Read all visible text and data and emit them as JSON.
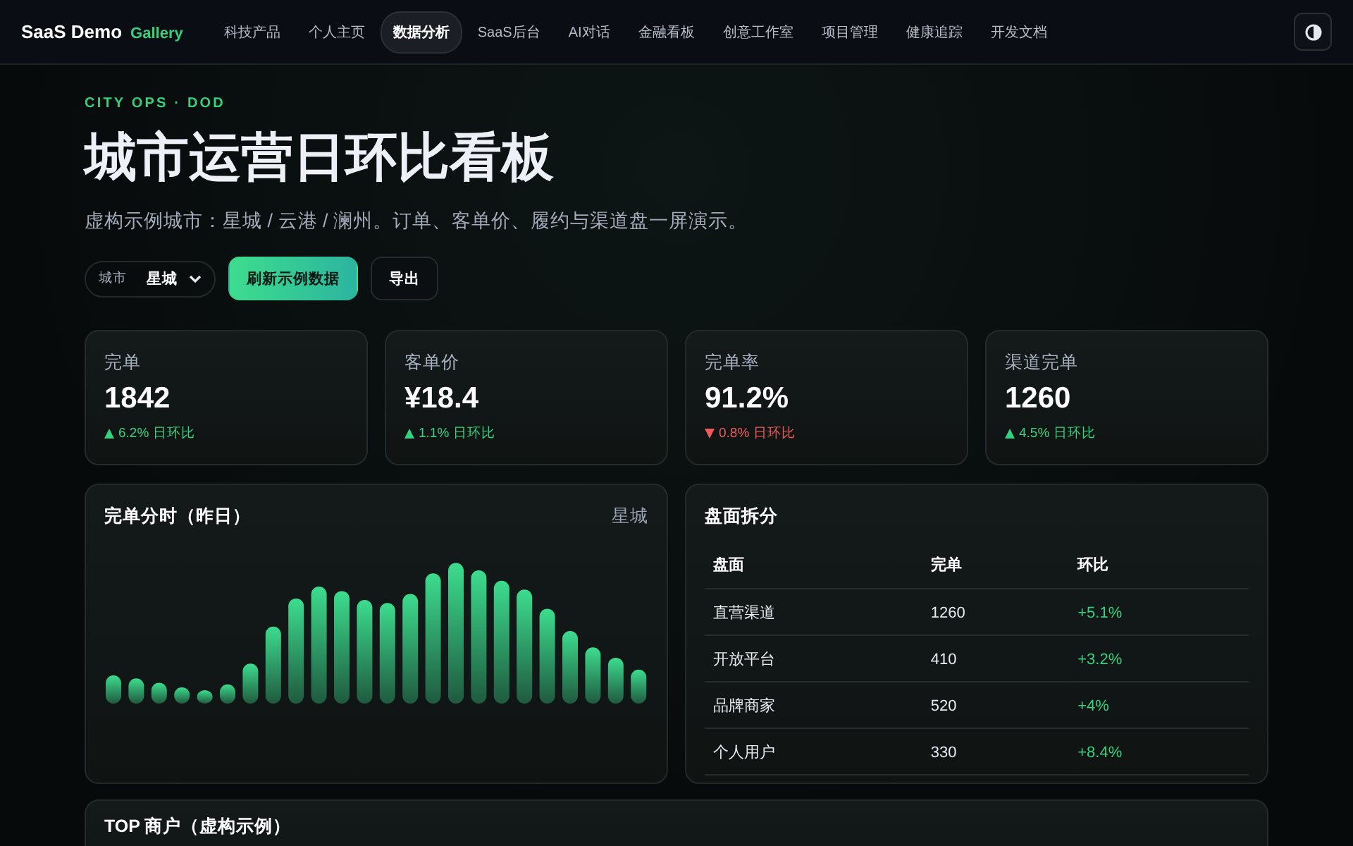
{
  "brand": {
    "name": "SaaS Demo",
    "tag": "Gallery"
  },
  "nav": [
    {
      "label": "科技产品",
      "selected": false
    },
    {
      "label": "个人主页",
      "selected": false
    },
    {
      "label": "数据分析",
      "selected": true
    },
    {
      "label": "SaaS后台",
      "selected": false
    },
    {
      "label": "AI对话",
      "selected": false
    },
    {
      "label": "金融看板",
      "selected": false
    },
    {
      "label": "创意工作室",
      "selected": false
    },
    {
      "label": "项目管理",
      "selected": false
    },
    {
      "label": "健康追踪",
      "selected": false
    },
    {
      "label": "开发文档",
      "selected": false
    }
  ],
  "eyebrow": "CITY OPS · DOD",
  "title": "城市运营日环比看板",
  "subtitle": "虚构示例城市：星城 / 云港 / 澜州。订单、客单价、履约与渠道盘一屏演示。",
  "city_select": {
    "label": "城市",
    "value": "星城"
  },
  "buttons": [
    {
      "label": "刷新示例数据",
      "kind": "primary"
    },
    {
      "label": "导出",
      "kind": "ghost"
    }
  ],
  "kpis": [
    {
      "label": "完单",
      "value": "1842",
      "rising": true,
      "delta": "6.2% 日环比"
    },
    {
      "label": "客单价",
      "value": "¥18.4",
      "rising": true,
      "delta": "1.1% 日环比"
    },
    {
      "label": "完单率",
      "value": "91.2%",
      "rising": false,
      "delta": "0.8% 日环比"
    },
    {
      "label": "渠道完单",
      "value": "1260",
      "rising": true,
      "delta": "4.5% 日环比"
    }
  ],
  "hourly_card": {
    "title": "完单分时（昨日）",
    "city": "星城"
  },
  "breakdown": {
    "title": "盘面拆分",
    "columns": [
      "盘面",
      "完单",
      "环比"
    ],
    "rows": [
      [
        "直营渠道",
        "1260",
        "+5.1%"
      ],
      [
        "开放平台",
        "410",
        "+3.2%"
      ],
      [
        "品牌商家",
        "520",
        "+4%"
      ],
      [
        "个人用户",
        "330",
        "+8.4%"
      ]
    ]
  },
  "top_card": {
    "title": "TOP 商户（虚构示例）"
  }
}
